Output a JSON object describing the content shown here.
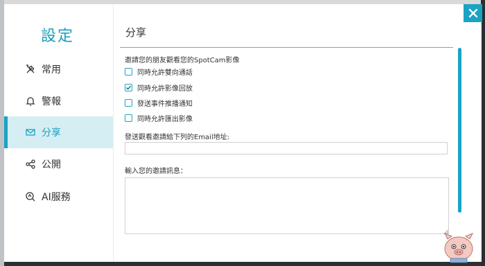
{
  "sidebar": {
    "title": "設定",
    "items": [
      {
        "label": "常用",
        "icon": "tools-icon"
      },
      {
        "label": "警報",
        "icon": "bell-icon"
      },
      {
        "label": "分享",
        "icon": "envelope-icon",
        "active": true
      },
      {
        "label": "公開",
        "icon": "share-nodes-icon"
      },
      {
        "label": "AI服務",
        "icon": "ai-search-icon"
      }
    ]
  },
  "content": {
    "title": "分享",
    "intro": "邀請您的朋友觀看您的SpotCam影像",
    "options": [
      {
        "label": "同時允許雙向通話",
        "checked": false
      },
      {
        "label": "同時允許影像回放",
        "checked": true
      },
      {
        "label": "發送事件推播通知",
        "checked": false
      },
      {
        "label": "同時允許匯出影像",
        "checked": false
      }
    ],
    "email_label": "發送觀看邀請給下列的Email地址:",
    "email_value": "",
    "message_label": "輸入您的邀請訊息：",
    "message_value": ""
  },
  "colors": {
    "accent": "#1aa3c3",
    "active_bg": "#d5eef4",
    "text": "#333333"
  },
  "close_icon": "close-icon"
}
